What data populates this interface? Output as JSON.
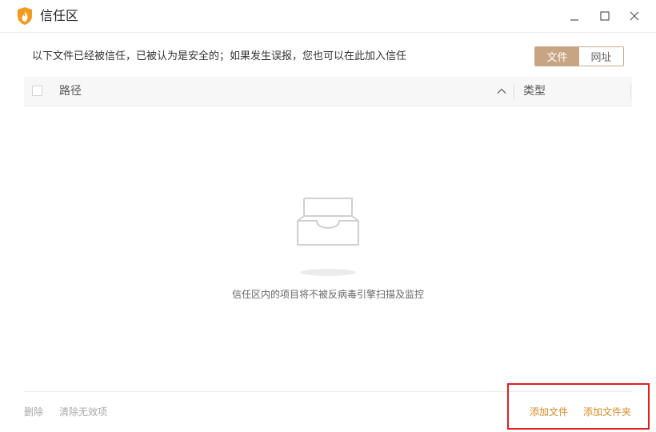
{
  "window": {
    "title": "信任区"
  },
  "toolbar": {
    "description": "以下文件已经被信任，已被认为是安全的；如果发生误报，您也可以在此加入信任",
    "tabs": [
      {
        "label": "文件",
        "active": true
      },
      {
        "label": "网址",
        "active": false
      }
    ]
  },
  "table": {
    "columns": {
      "path": "路径",
      "type": "类型"
    },
    "sort_icon": "chevron-up-icon"
  },
  "empty_state": {
    "icon": "empty-tray-icon",
    "message": "信任区内的项目将不被反病毒引擎扫描及监控"
  },
  "footer": {
    "delete_label": "删除",
    "clean_label": "清除无效项",
    "add_file_label": "添加文件",
    "add_folder_label": "添加文件夹"
  },
  "colors": {
    "accent": "#c7a583",
    "link_orange": "#d88a25",
    "highlight": "#e02020",
    "logo_orange": "#f39a1e"
  }
}
